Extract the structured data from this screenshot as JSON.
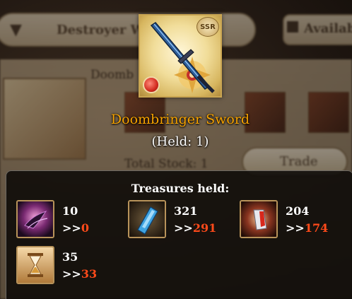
{
  "background": {
    "filter_label": "Destroyer W",
    "available_label": "Availab",
    "item_name_partial": "Doomb",
    "stock_label": "Total Stock: 1",
    "trade_label": "Trade"
  },
  "item": {
    "name": "Doombringer Sword",
    "held": "(Held: 1)",
    "rarity": "SSR",
    "icon": "sword-icon",
    "element_icon": "fire-element-icon"
  },
  "treasures": {
    "title": "Treasures held:",
    "items": [
      {
        "icon": "dark-claw-icon",
        "count": "10",
        "arrow": ">>",
        "after": "0"
      },
      {
        "icon": "blue-crystal-icon",
        "count": "321",
        "arrow": ">>",
        "after": "291"
      },
      {
        "icon": "red-shard-icon",
        "count": "204",
        "arrow": ">>",
        "after": "174"
      },
      {
        "icon": "hourglass-icon",
        "count": "35",
        "arrow": ">>",
        "after": "33"
      }
    ]
  },
  "colors": {
    "item_name": "#f7a300",
    "after_value": "#ff4a1a",
    "text": "#ffffff"
  }
}
